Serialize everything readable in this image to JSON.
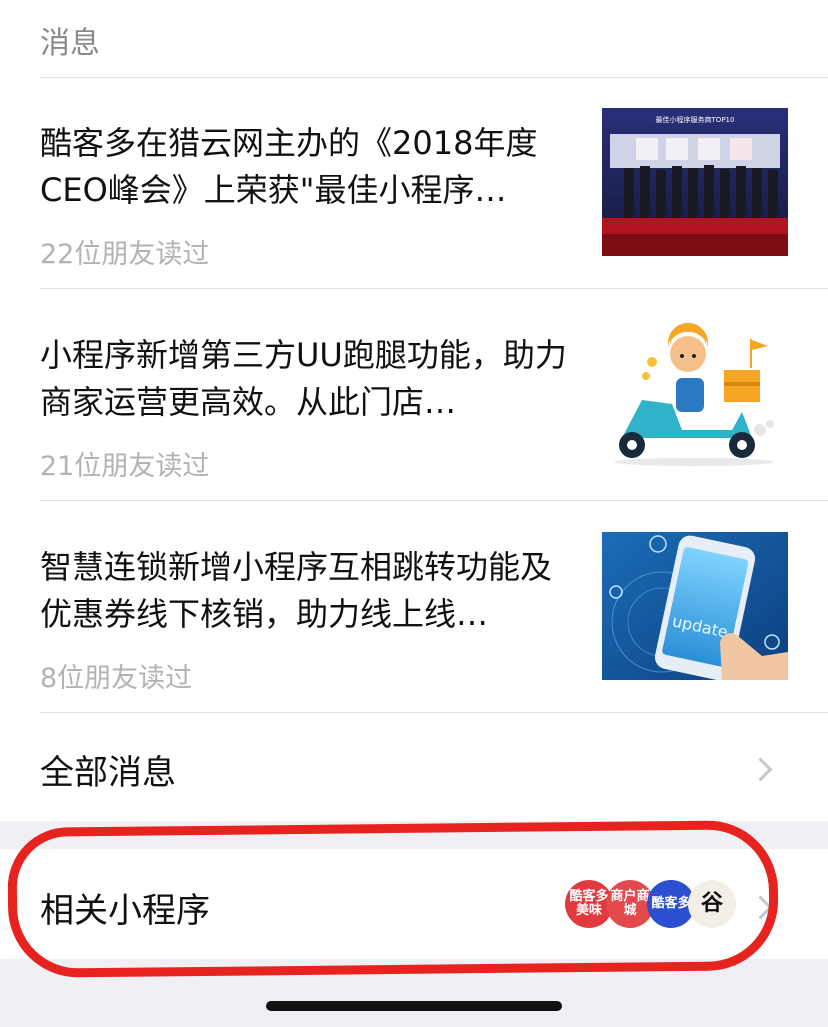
{
  "section": {
    "title": "消息"
  },
  "articles": [
    {
      "title": "酷客多在猎云网主办的《2018年度CEO峰会》上荣获\"最佳小程序…",
      "readers": "22位朋友读过"
    },
    {
      "title": "小程序新增第三方UU跑腿功能，助力商家运营更高效。从此门店…",
      "readers": "21位朋友读过"
    },
    {
      "title": "智慧连锁新增小程序互相跳转功能及优惠券线下核销，助力线上线…",
      "readers": "8位朋友读过"
    }
  ],
  "thumb_texts": {
    "award_banner": "最佳小程序服务商TOP10",
    "phone_screen": "update"
  },
  "all_messages": {
    "label": "全部消息"
  },
  "related": {
    "label": "相关小程序",
    "icons": [
      {
        "name": "kukeduo-meiwei",
        "text": "酷客多 美味",
        "color": "#e03a3e"
      },
      {
        "name": "merchant-store",
        "text": "商户商城",
        "color": "#e34a4d"
      },
      {
        "name": "kukeduo-blue",
        "text": "酷客多",
        "color": "#2a4fd1"
      },
      {
        "name": "calligraphy",
        "text": "谷",
        "color": "#f3efe6"
      }
    ]
  },
  "colors": {
    "annotation": "#e6231f",
    "divider": "#e2e2e2",
    "muted": "#b3b3b3"
  }
}
